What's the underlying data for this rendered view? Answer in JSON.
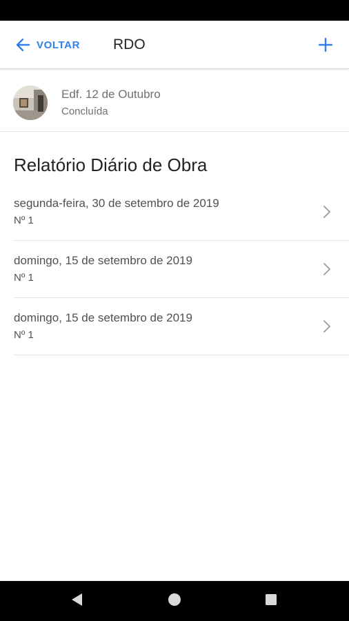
{
  "app_bar": {
    "back_label": "VOLTAR",
    "title": "RDO",
    "back_icon": "arrow-left-icon",
    "add_icon": "plus-icon",
    "accent_color": "#2f80ed"
  },
  "project": {
    "name": "Edf. 12 de Outubro",
    "status": "Concluída",
    "avatar": "project-photo"
  },
  "section": {
    "title": "Relatório Diário de Obra"
  },
  "reports": [
    {
      "date": "segunda-feira, 30 de setembro de 2019",
      "number": "Nº 1"
    },
    {
      "date": "domingo, 15 de setembro de 2019",
      "number": "Nº 1"
    },
    {
      "date": "domingo, 15 de setembro de 2019",
      "number": "Nº 1"
    }
  ],
  "nav_bar": {
    "back_icon": "triangle-back-icon",
    "home_icon": "circle-home-icon",
    "recents_icon": "square-recents-icon"
  }
}
